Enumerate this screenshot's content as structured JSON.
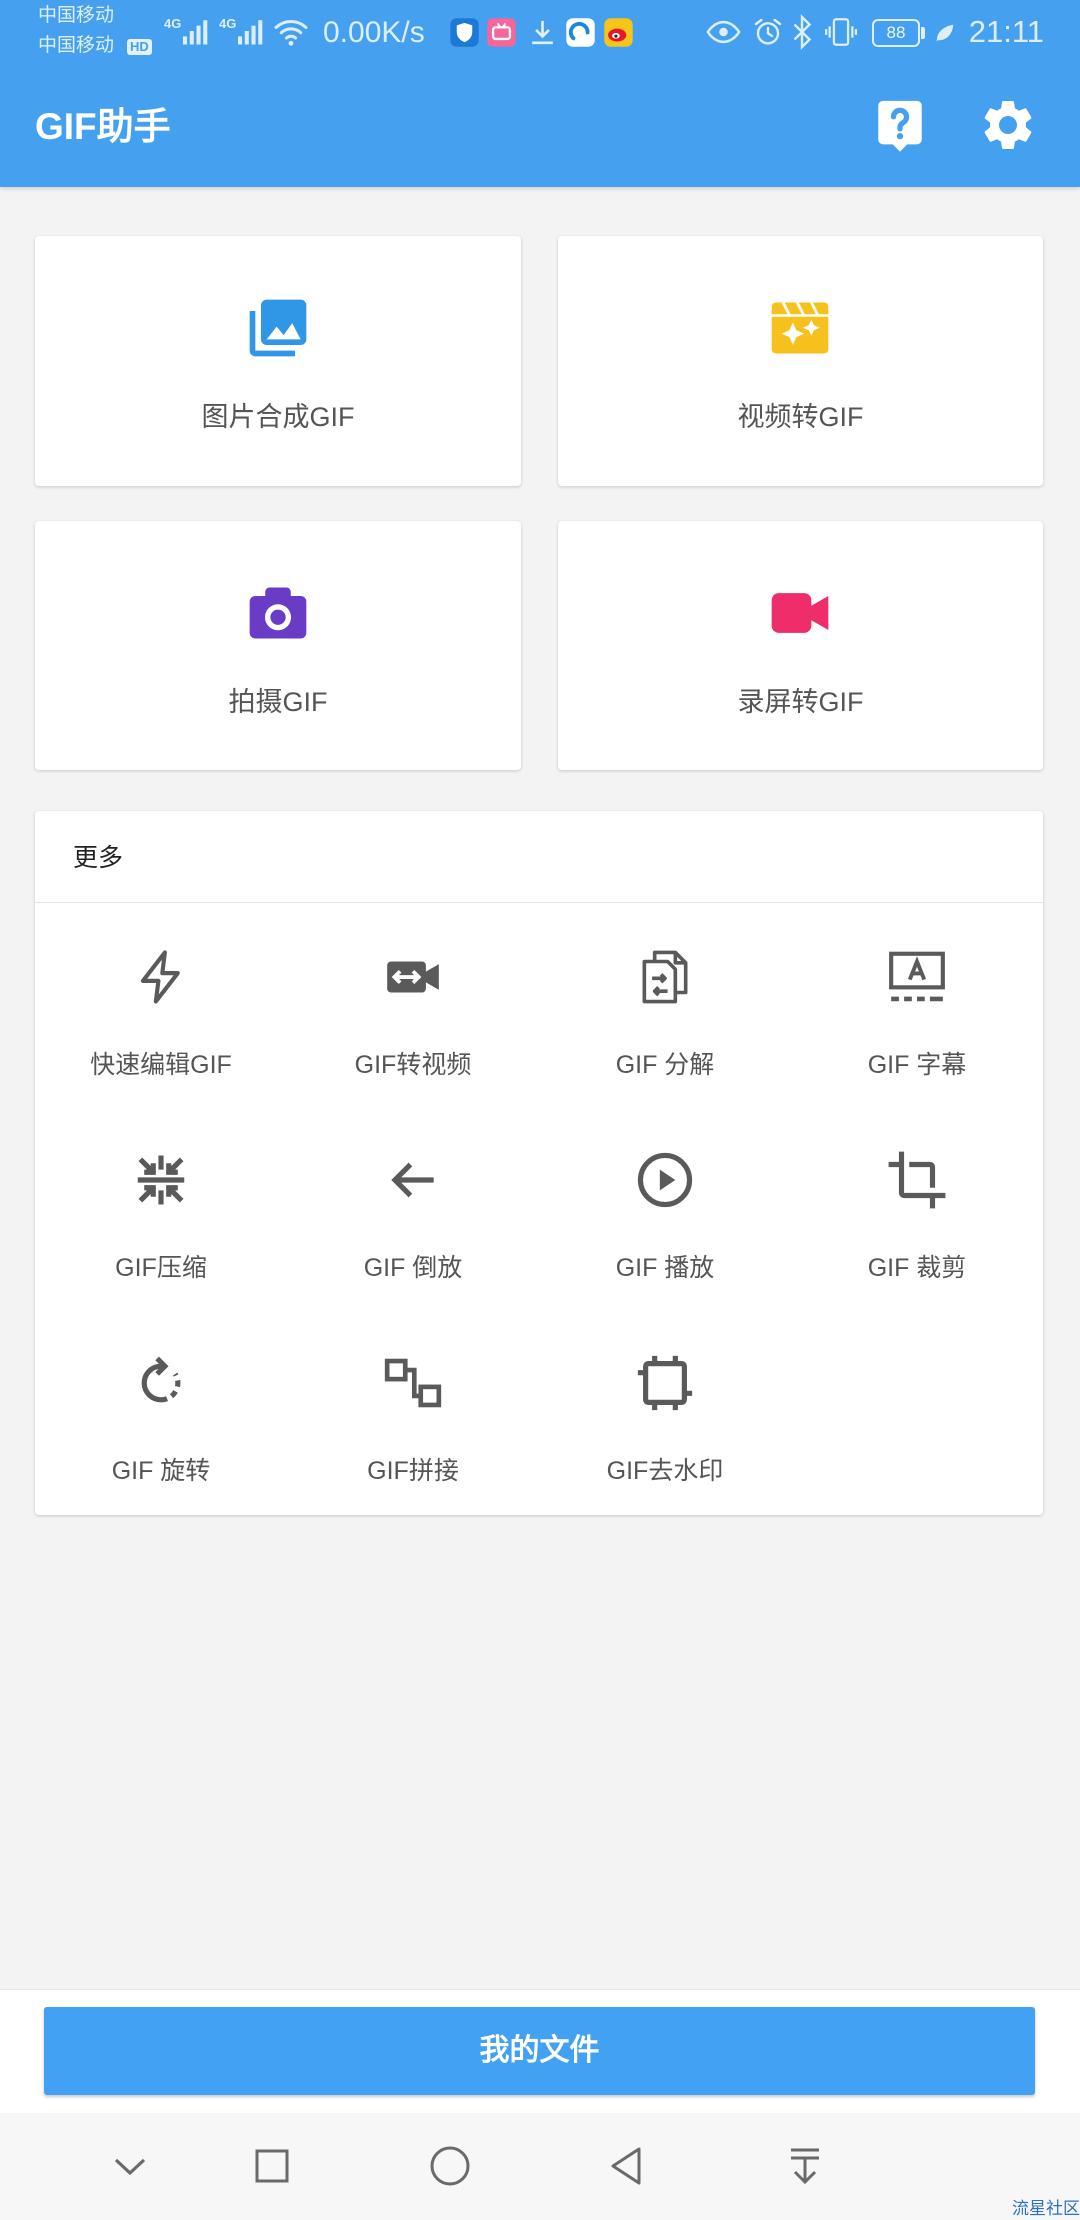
{
  "status_bar": {
    "carrier_1": "中国移动",
    "carrier_2": "中国移动",
    "hd_badge": "HD",
    "sim1_network": "4G",
    "sim2_network": "4G",
    "net_speed": "0.00K/s",
    "notification_icons": [
      "shield-app-icon",
      "bilibili-app-icon",
      "download-icon",
      "browser-app-icon",
      "weibo-app-icon"
    ],
    "status_icons": [
      "eye-icon",
      "alarm-icon",
      "bluetooth-icon",
      "vibrate-icon",
      "leaf-icon"
    ],
    "battery_level": "88",
    "time": "21:11"
  },
  "app_bar": {
    "title": "GIF助手",
    "actions": [
      {
        "icon": "help-icon"
      },
      {
        "icon": "settings-icon"
      }
    ]
  },
  "main_cards": [
    {
      "label": "图片合成GIF",
      "icon": "photo-library-icon",
      "color": "#2f97e6"
    },
    {
      "label": "视频转GIF",
      "icon": "movie-filter-icon",
      "color": "#f6c11c"
    },
    {
      "label": "拍摄GIF",
      "icon": "camera-icon",
      "color": "#6a3bc4"
    },
    {
      "label": "录屏转GIF",
      "icon": "videocam-icon",
      "color": "#ee2d6a"
    }
  ],
  "more": {
    "title": "更多",
    "items": [
      {
        "label": "快速编辑GIF",
        "icon": "flash-icon"
      },
      {
        "label": "GIF转视频",
        "icon": "video-convert-icon"
      },
      {
        "label": "GIF 分解",
        "icon": "decompose-icon"
      },
      {
        "label": "GIF 字幕",
        "icon": "subtitles-icon"
      },
      {
        "label": "GIF压缩",
        "icon": "compress-icon"
      },
      {
        "label": "GIF 倒放",
        "icon": "arrow-left-icon"
      },
      {
        "label": "GIF 播放",
        "icon": "play-icon"
      },
      {
        "label": "GIF 裁剪",
        "icon": "crop-icon"
      },
      {
        "label": "GIF 旋转",
        "icon": "rotate-icon"
      },
      {
        "label": "GIF拼接",
        "icon": "concat-icon"
      },
      {
        "label": "GIF去水印",
        "icon": "watermark-remove-icon"
      }
    ]
  },
  "bottom": {
    "my_files_label": "我的文件"
  },
  "nav_bar": {
    "buttons": [
      "collapse-icon",
      "recents-icon",
      "home-icon",
      "back-icon",
      "pull-down-icon"
    ]
  },
  "watermark": "流星社区",
  "colors": {
    "primary": "#45a1ef",
    "button": "#42a1f2",
    "background": "#f3f3f3",
    "icon_gray": "#5a5a5a",
    "label_gray": "#555555"
  }
}
